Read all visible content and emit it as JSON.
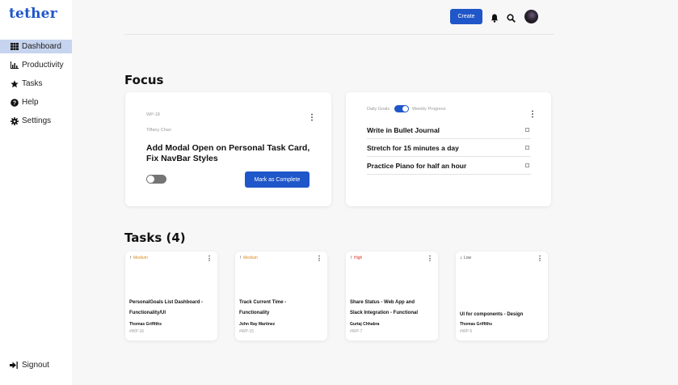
{
  "app": {
    "logo": "tether"
  },
  "sidebar": {
    "items": [
      {
        "label": "Dashboard",
        "icon": "grid-icon",
        "active": true
      },
      {
        "label": "Productivity",
        "icon": "bar-chart-icon",
        "active": false
      },
      {
        "label": "Tasks",
        "icon": "star-icon",
        "active": false
      },
      {
        "label": "Help",
        "icon": "question-circle-icon",
        "active": false
      },
      {
        "label": "Settings",
        "icon": "gear-icon",
        "active": false
      }
    ],
    "signout_label": "Signout"
  },
  "header": {
    "create_label": "Create",
    "accent_color": "#1f56c9"
  },
  "focus": {
    "title": "Focus",
    "card": {
      "id": "WP-18",
      "assignee": "Tiffany Chan",
      "title": "Add Modal Open on Personal Task Card, Fix NavBar Styles",
      "button_label": "Mark as Complete",
      "toggle_on": false
    },
    "goals": {
      "left_label": "Daily Goals",
      "right_label": "Weekly Progress",
      "toggle_on": true,
      "items": [
        {
          "text": "Write in Bullet Journal",
          "checked": false
        },
        {
          "text": "Stretch for 15 minutes a day",
          "checked": false
        },
        {
          "text": "Practice Piano for half an hour",
          "checked": false
        }
      ]
    }
  },
  "tasks": {
    "title": "Tasks (4)",
    "items": [
      {
        "priority": "Medium",
        "priority_color": "#e08a1e",
        "direction": "up",
        "title_lines": [
          "PersonalGoals List Dashboard -",
          "Functionality/UI"
        ],
        "assignee": "Thomas Griffiths",
        "id": "#WP-16"
      },
      {
        "priority": "Medium",
        "priority_color": "#e08a1e",
        "direction": "up",
        "title_lines": [
          "Track Current Time -",
          "Functionality"
        ],
        "assignee": "John Ray Martinez",
        "id": "#WP-15"
      },
      {
        "priority": "High",
        "priority_color": "#d93025",
        "direction": "up",
        "title_lines": [
          "Share Status - Web App and",
          "Slack Integration - Functional"
        ],
        "assignee": "Gurtaj Chhabra",
        "id": "#WP-7"
      },
      {
        "priority": "Low",
        "priority_color": "#555555",
        "direction": "down",
        "title_lines": [
          "UI for components - Design"
        ],
        "assignee": "Thomas Griffiths",
        "id": "#WP-5"
      }
    ]
  }
}
